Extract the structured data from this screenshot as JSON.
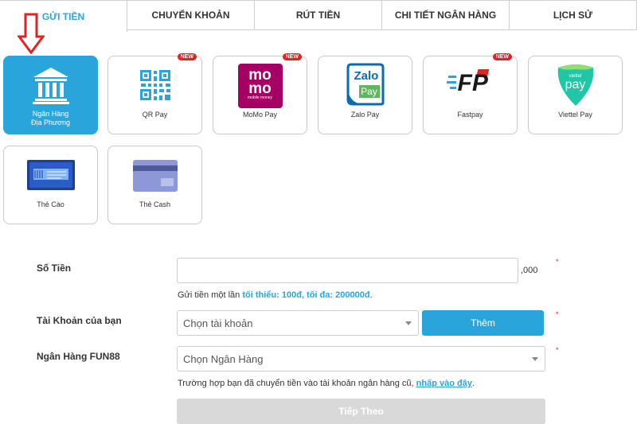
{
  "tabs": [
    {
      "label": "GỬI TIỀN",
      "active": true
    },
    {
      "label": "CHUYỂN KHOẢN"
    },
    {
      "label": "RÚT TIỀN"
    },
    {
      "label": "CHI TIẾT NGÂN HÀNG"
    },
    {
      "label": "LỊCH SỬ"
    }
  ],
  "methods": [
    {
      "label_line1": "Ngân Hàng",
      "label_line2": "Địa Phương",
      "icon": "bank-icon",
      "active": true
    },
    {
      "label": "QR Pay",
      "icon": "qr-code-icon",
      "badge": "NEW"
    },
    {
      "label": "MoMo Pay",
      "icon": "momo-logo",
      "badge": "NEW",
      "logo_text_1": "mo",
      "logo_text_2": "mo",
      "logo_small": "mobile money"
    },
    {
      "label": "Zalo Pay",
      "icon": "zalopay-logo",
      "logo_text_1": "Zalo",
      "logo_text_2": "Pay"
    },
    {
      "label": "Fastpay",
      "icon": "fastpay-logo",
      "badge": "NEW",
      "logo_text": "FP"
    },
    {
      "label": "Viettel Pay",
      "icon": "viettelpay-logo",
      "logo_small": "viettel",
      "logo_text": "pay"
    },
    {
      "label": "Thẻ Cào",
      "icon": "scratch-card-icon"
    },
    {
      "label": "Thẻ Cash",
      "icon": "cash-card-icon"
    }
  ],
  "form": {
    "amount": {
      "label": "Số Tiền",
      "value": "",
      "suffix": ",000"
    },
    "amount_hint": {
      "prefix": "Gửi tiền một lần",
      "min_label": "tối thiểu:",
      "min_value": "100đ,",
      "max_label": "tối đa:",
      "max_value": "200000đ",
      "end": "."
    },
    "account": {
      "label": "Tài Khoản của bạn",
      "selected": "Chọn tài khoản"
    },
    "add_button": "Thêm",
    "bank": {
      "label": "Ngân Hàng FUN88",
      "selected": "Chọn Ngân Hàng"
    },
    "old_bank_hint": {
      "text": "Trường hợp bạn đã chuyển tiền vào tài khoản ngân hàng cũ,",
      "link": "nhấp vào đây",
      "end": "."
    },
    "next_button": "Tiếp Theo",
    "required_mark": "*"
  },
  "colors": {
    "accent": "#2aa5dc",
    "required": "#e32222",
    "momo": "#a50064",
    "zalo": "#0a6bb1",
    "viettel": "#1fc7a6"
  }
}
